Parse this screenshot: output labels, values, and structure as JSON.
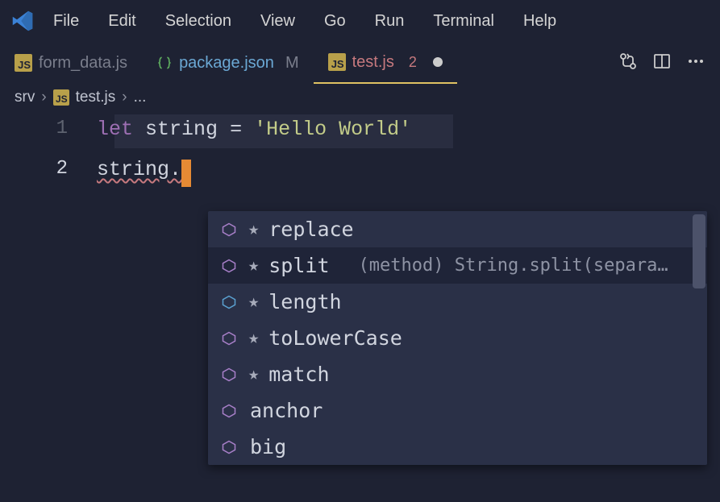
{
  "menu": [
    "File",
    "Edit",
    "Selection",
    "View",
    "Go",
    "Run",
    "Terminal",
    "Help"
  ],
  "tabs": [
    {
      "name": "form_data.js",
      "type": "js",
      "active": false,
      "modified": ""
    },
    {
      "name": "package.json",
      "type": "json",
      "active": false,
      "modified": "M"
    },
    {
      "name": "test.js",
      "type": "js",
      "active": true,
      "problems": "2",
      "dirty": true
    }
  ],
  "breadcrumb": {
    "folder": "srv",
    "file": "test.js",
    "rest": "..."
  },
  "code": {
    "line1": {
      "num": "1",
      "keyword": "let",
      "var": "string",
      "op": "=",
      "string": "'Hello World'"
    },
    "line2": {
      "num": "2",
      "text": "string."
    }
  },
  "suggest": {
    "items": [
      {
        "label": "replace",
        "kind": "method",
        "star": true
      },
      {
        "label": "split",
        "kind": "method",
        "star": true,
        "detail": "(method) String.split(separa…",
        "selected": true
      },
      {
        "label": "length",
        "kind": "field",
        "star": true
      },
      {
        "label": "toLowerCase",
        "kind": "method",
        "star": true
      },
      {
        "label": "match",
        "kind": "method",
        "star": true
      },
      {
        "label": "anchor",
        "kind": "method",
        "star": false
      },
      {
        "label": "big",
        "kind": "method",
        "star": false
      }
    ]
  }
}
